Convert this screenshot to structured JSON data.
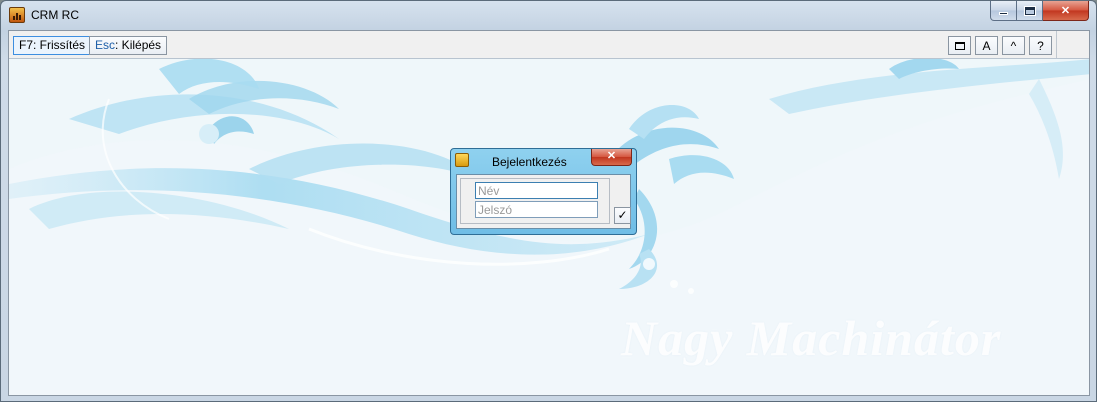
{
  "window": {
    "title": "CRM RC",
    "caption_close": "✕"
  },
  "toolbar": {
    "refresh": {
      "key": "F7",
      "label": ": Frissítés"
    },
    "exit": {
      "key": "Esc",
      "label": ": Kilépés"
    },
    "font_button": "A",
    "up_button": "^",
    "help_button": "?"
  },
  "background": {
    "watermark": "Nagy Machinátor"
  },
  "login_dialog": {
    "title": "Bejelentkezés",
    "close": "✕",
    "name_placeholder": "Név",
    "password_placeholder": "Jelszó",
    "ok": "✓"
  },
  "colors": {
    "accent": "#3d8ee0",
    "dialog_frame": "#7fc7ec",
    "close_red": "#c1361f",
    "floral": "#a9dcf1"
  },
  "icons": [
    "app-icon",
    "minimize-icon",
    "maximize-icon",
    "close-icon",
    "window-icon",
    "login-icon",
    "checkmark-icon"
  ]
}
